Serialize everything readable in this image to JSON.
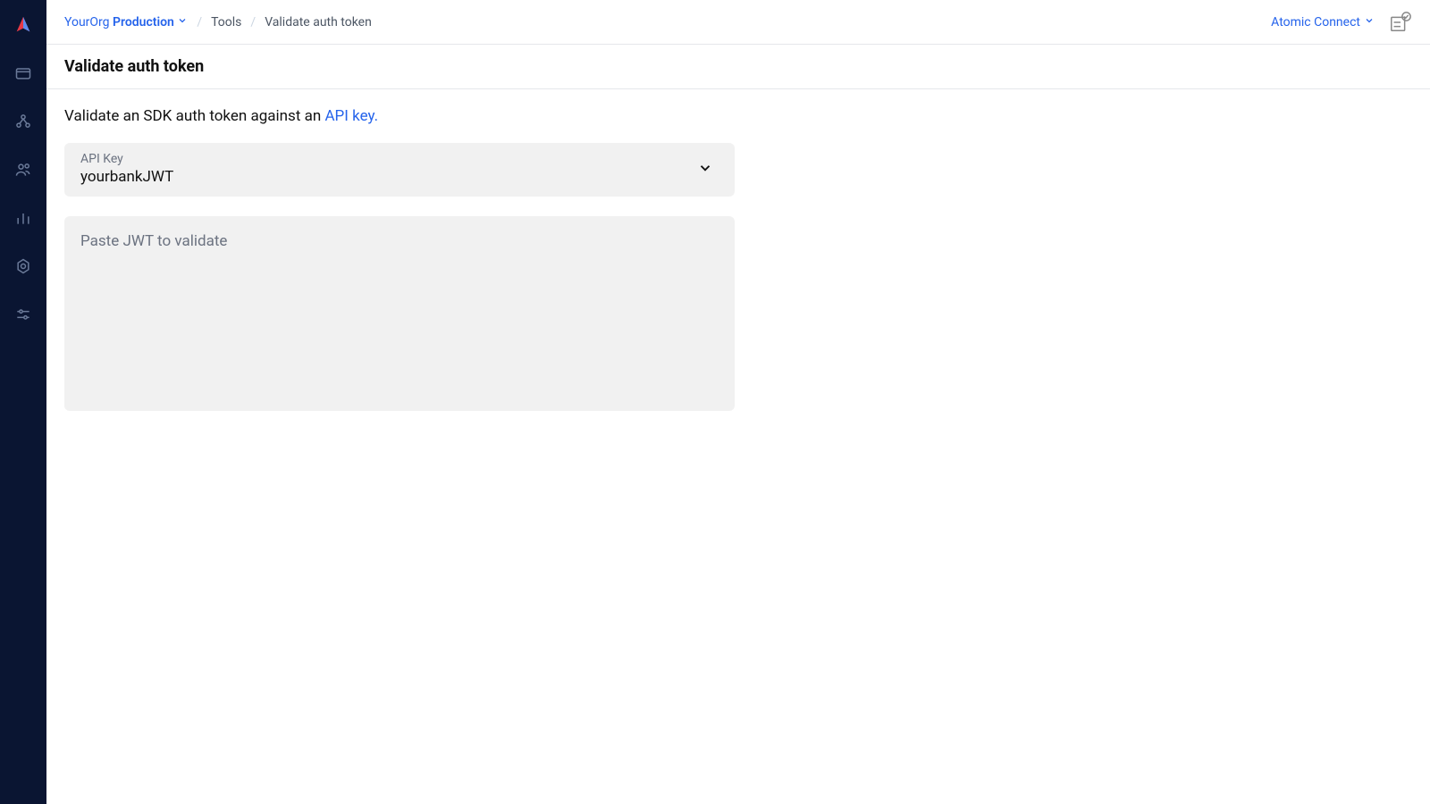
{
  "breadcrumb": {
    "org": "YourOrg",
    "env": "Production",
    "tools": "Tools",
    "current": "Validate auth token"
  },
  "topbar": {
    "connect_label": "Atomic Connect"
  },
  "page": {
    "title": "Validate auth token",
    "description_prefix": "Validate an SDK auth token against an ",
    "description_link": "API key."
  },
  "form": {
    "api_key_label": "API Key",
    "api_key_value": "yourbankJWT",
    "jwt_placeholder": "Paste JWT to validate"
  }
}
